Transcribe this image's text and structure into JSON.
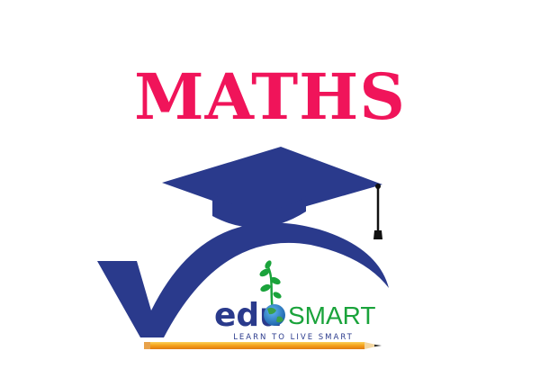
{
  "page": {
    "title": "MATHS"
  },
  "logo": {
    "brand_prefix": "edu",
    "brand_suffix": "SMART",
    "tagline": "LEARN TO LIVE SMART",
    "colors": {
      "title": "#f0145a",
      "navy": "#2a3a8c",
      "green": "#1aa33b",
      "pencil": "#f4a018"
    }
  }
}
